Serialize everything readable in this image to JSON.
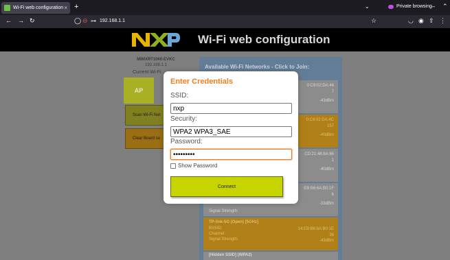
{
  "browser": {
    "tab_title": "Wi-Fi web configuration",
    "tab_close": "×",
    "new_tab": "+",
    "url": "192.168.1.1",
    "private_label": "Private browsing",
    "tab_overflow": "⌄",
    "icons": [
      "back-arrow-icon",
      "forward-arrow-icon",
      "reload-icon",
      "shield-icon",
      "lock-warning-icon",
      "key-icon",
      "bookmark-star-icon",
      "pocket-icon",
      "account-icon",
      "extensions-icon",
      "menu-icon"
    ]
  },
  "page": {
    "title": "Wi-Fi web configuration",
    "logo_text": "NXP",
    "device_name": "MIMXRT1060-EVKC",
    "device_ip": "192.168.1.1",
    "current_label": "Current Wi-Fi",
    "ap_label": "AP",
    "scan_button": "Scan Wi-Fi Net",
    "clear_button": "Clear Board se",
    "colors": {
      "header_bg": "#000000",
      "body_bg": "#7f7f7f",
      "accent_orange": "#ef7d22",
      "connect_green": "#c8d400"
    }
  },
  "networks": {
    "header": "Available Wi-Fi Networks - Click to Join:",
    "items": [
      {
        "name": "",
        "mac": "0:C9:02:DA:46",
        "channel": "7",
        "signal": "-43dBm",
        "security_label": "",
        "channel_label": "",
        "signal_label": "",
        "selected": false
      },
      {
        "name": "",
        "mac": "0:C9:02:DA:4C",
        "channel": "157",
        "signal": "-40dBm",
        "security_label": "",
        "channel_label": "",
        "signal_label": "",
        "selected": true
      },
      {
        "name": "",
        "mac": "CD:21:48:8A:66",
        "channel": "1",
        "signal": "-40dBm",
        "security_label": "",
        "channel_label": "",
        "signal_label": "",
        "selected": false
      },
      {
        "name": "",
        "mac": "EB:B6:6A:B0:1F",
        "channel": "6",
        "signal": "-33dBm",
        "security_label": "",
        "channel_label": "",
        "signal_label": "Signal Strength:",
        "selected": false
      },
      {
        "name": "TP-link-5G (Open) [5GHz]",
        "mac": "14:EB:B6:6A:B0:1E",
        "channel": "36",
        "signal": "-43dBm",
        "security_label": "BSSID:",
        "channel_label": "Channel:",
        "signal_label": "Signal Strength:",
        "selected": true
      }
    ],
    "hidden_label": "[Hidden SSID] (WPA2)"
  },
  "modal": {
    "title": "Enter Credentials",
    "ssid_label": "SSID:",
    "ssid_value": "nxp",
    "security_label": "Security:",
    "security_value": "WPA2 WPA3_SAE",
    "password_label": "Password:",
    "password_value": "•••••••••",
    "show_password_label": "Show Password",
    "show_password_checked": false,
    "connect_label": "Connect"
  }
}
